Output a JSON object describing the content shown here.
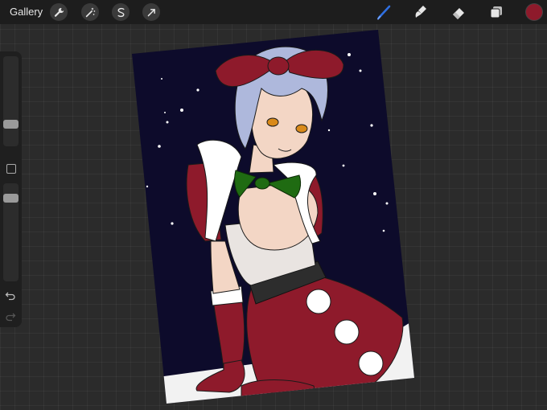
{
  "topbar": {
    "gallery_label": "Gallery",
    "left_tools": [
      "wrench-icon",
      "magic-wand-icon",
      "selection-icon",
      "transform-arrow-icon"
    ],
    "right_tools": [
      "brush-icon",
      "smudge-icon",
      "eraser-icon",
      "layers-icon"
    ],
    "current_color": "#8e1a2b",
    "accent_color": "#2f6fe0"
  },
  "sidebar": {
    "brush_size_level": 0.78,
    "opacity_level": 0.12,
    "controls": [
      "brush-size-slider",
      "modify-button",
      "opacity-slider",
      "undo-icon",
      "redo-icon"
    ]
  },
  "canvas": {
    "artwork": "illustration",
    "background_color": "#0d0b2b"
  }
}
